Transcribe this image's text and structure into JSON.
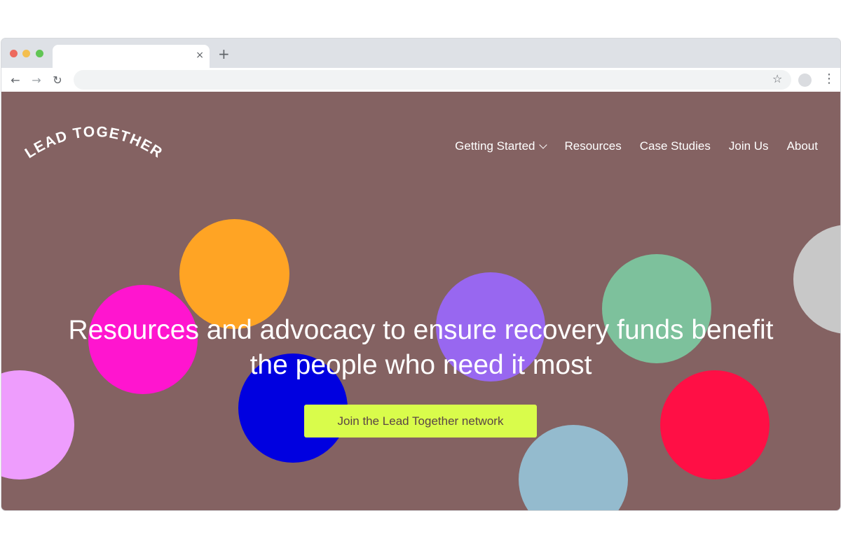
{
  "browser": {
    "tab_close_glyph": "×",
    "new_tab_glyph": "+",
    "back_glyph": "←",
    "forward_glyph": "→",
    "reload_glyph": "↻",
    "star_glyph": "☆",
    "menu_glyph": "⋮",
    "address_value": "",
    "traffic_lights": {
      "red": "#ed6a5e",
      "yellow": "#f4bf4f",
      "green": "#61c554"
    }
  },
  "site": {
    "background_color": "#846262",
    "logo_text": "LEAD TOGETHER",
    "nav": [
      {
        "label": "Getting Started",
        "has_dropdown": true
      },
      {
        "label": "Resources"
      },
      {
        "label": "Case Studies"
      },
      {
        "label": "Join Us"
      },
      {
        "label": "About"
      }
    ],
    "hero_line_1": "Resources and advocacy to ensure recovery funds benefit",
    "hero_line_2": "the people who need it most",
    "cta_label": "Join the Lead Together network",
    "cta_color": "#d9fc4b",
    "circle_colors": [
      "#ffa424",
      "#ff15cf",
      "#0000e0",
      "#ee9dfd",
      "#9867f0",
      "#7dc19c",
      "#ff0f45",
      "#94bbce",
      "#c8c8c8"
    ]
  }
}
